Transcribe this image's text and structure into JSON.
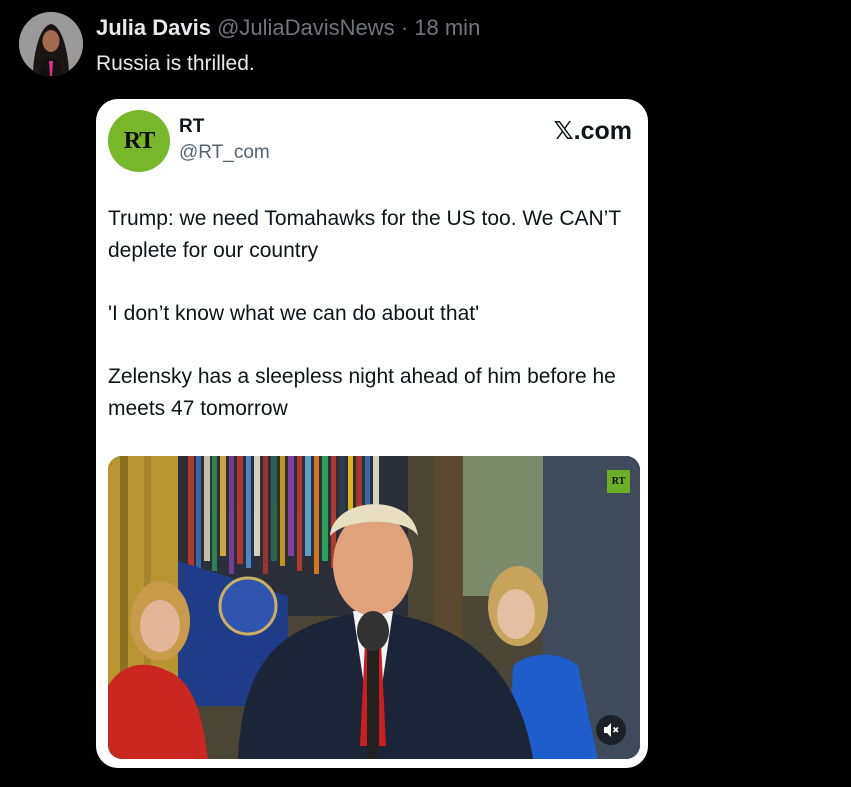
{
  "post": {
    "author_name": "Julia Davis",
    "author_handle": "@JuliaDavisNews",
    "separator": "·",
    "timestamp": "18 min",
    "text": "Russia is thrilled."
  },
  "quote": {
    "avatar_text": "RT",
    "name": "RT",
    "handle": "@RT_com",
    "brand_glyph": "𝕏",
    "brand_suffix": ".com",
    "paragraphs": [
      "Trump: we need Tomahawks for the US too. We CAN’T deplete for our country",
      "'I don’t know what we can do about that'",
      "Zelensky has a sleepless night ahead of him before he meets 47 tomorrow"
    ],
    "media": {
      "badge_text": "RT",
      "mute_icon": "speaker-muted-icon"
    }
  },
  "colors": {
    "background": "#000000",
    "rt_green": "#77b82a",
    "muted_text": "#71767b"
  }
}
